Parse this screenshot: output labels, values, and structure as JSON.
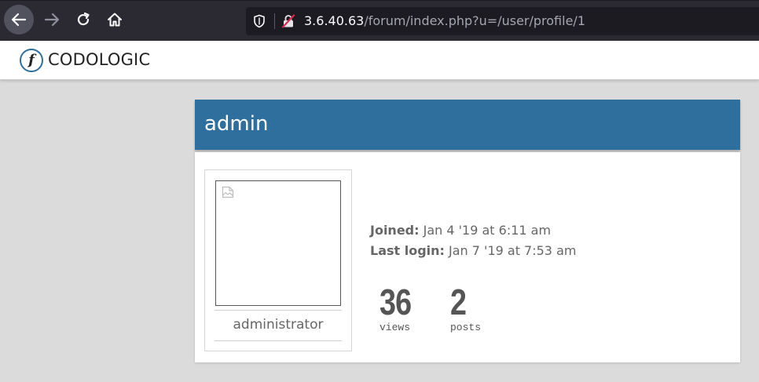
{
  "browser": {
    "url_host": "3.6.40.63",
    "url_path": "/forum/index.php?u=/user/profile/1",
    "icons": [
      "back-arrow-icon",
      "forward-arrow-icon",
      "reload-icon",
      "home-icon",
      "shield-icon",
      "insecure-lock-icon"
    ]
  },
  "site": {
    "logo_letter": "f",
    "logo_text": "CODOLOGIC"
  },
  "profile": {
    "username": "admin",
    "role": "administrator",
    "joined_label": "Joined:",
    "joined_value": "Jan 4 '19 at 6:11 am",
    "last_login_label": "Last login:",
    "last_login_value": "Jan 7 '19 at 7:53 am",
    "stats": [
      {
        "value": "36",
        "label": "views"
      },
      {
        "value": "2",
        "label": "posts"
      }
    ]
  },
  "colors": {
    "accent": "#2e6f9e",
    "page_bg": "#dcdbdc",
    "chrome_bg": "#2b2a33"
  }
}
